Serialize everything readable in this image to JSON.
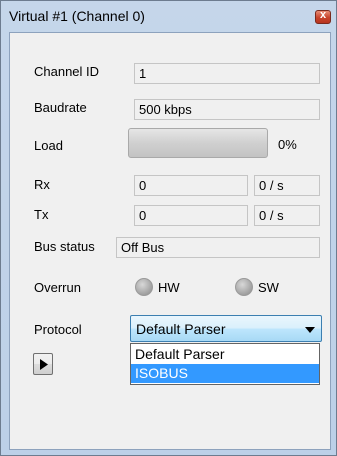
{
  "window": {
    "title": "Virtual #1 (Channel 0)",
    "close_glyph": "x"
  },
  "rows": {
    "channel_id": {
      "label": "Channel ID",
      "value": "1"
    },
    "baudrate": {
      "label": "Baudrate",
      "value": "500 kbps"
    },
    "load": {
      "label": "Load",
      "percent_text": "0%",
      "percent": 0
    },
    "rx": {
      "label": "Rx",
      "count": "0",
      "rate": "0 / s"
    },
    "tx": {
      "label": "Tx",
      "count": "0",
      "rate": "0 / s"
    },
    "bus_status": {
      "label": "Bus status",
      "value": "Off Bus"
    },
    "overrun": {
      "label": "Overrun",
      "hw_label": "HW",
      "sw_label": "SW"
    },
    "protocol": {
      "label": "Protocol",
      "selected": "Default Parser",
      "options": [
        "Default Parser",
        "ISOBUS"
      ],
      "highlighted_index": 1
    }
  },
  "colors": {
    "highlight": "#3399ff",
    "progress_fill": "#06b025"
  },
  "icons": {
    "close": "close-icon",
    "play": "play-icon",
    "dropdown": "chevron-down-icon"
  }
}
